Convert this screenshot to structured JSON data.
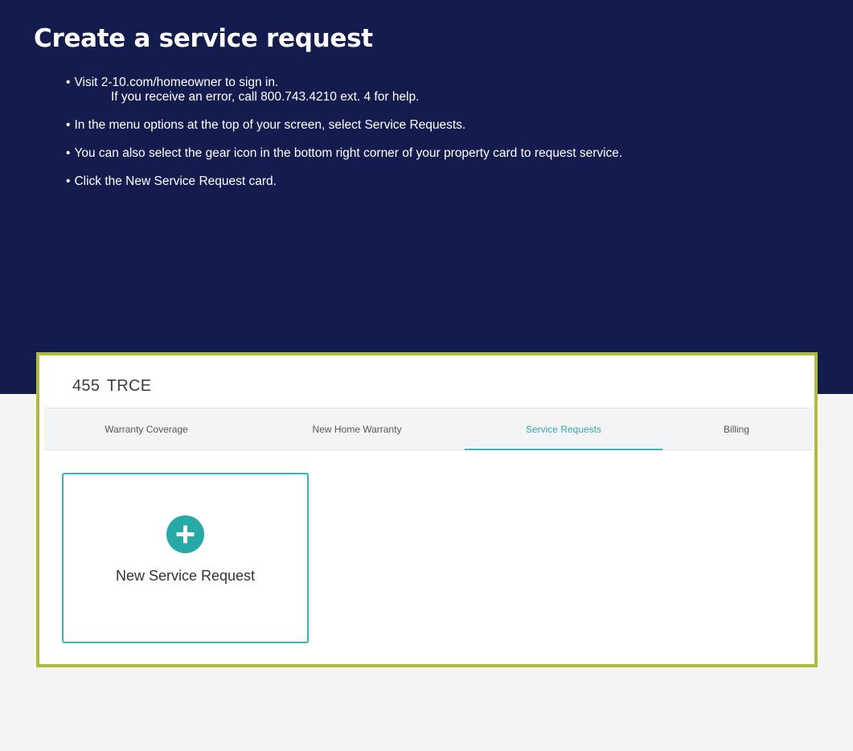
{
  "hero": {
    "title": "Create a service request",
    "steps": [
      {
        "bullet": "•",
        "text": "Visit 2-10.com/homeowner to sign in.",
        "sub": "If you receive an error, call 800.743.4210 ext. 4 for help."
      },
      {
        "bullet": "•",
        "text": "In the menu options at the top of your screen, select Service Requests."
      },
      {
        "bullet": "•",
        "text": "You can also select the gear icon in the bottom right corner of your property card to request service."
      },
      {
        "bullet": "•",
        "text": "Click the New Service Request card."
      }
    ]
  },
  "portal": {
    "property_name": "455 TRCE",
    "tabs": [
      {
        "label": "Warranty Coverage"
      },
      {
        "label": "New Home Warranty"
      },
      {
        "label": "Service Requests"
      },
      {
        "label": "Billing"
      }
    ],
    "active_tab": "Service Requests",
    "new_request_card": {
      "label": "New Service Request",
      "icon": "plus-circle-icon"
    }
  },
  "colors": {
    "hero_background": "#141c4e",
    "highlight_border": "#b1bb3b",
    "accent_teal": "#27a9a8"
  }
}
